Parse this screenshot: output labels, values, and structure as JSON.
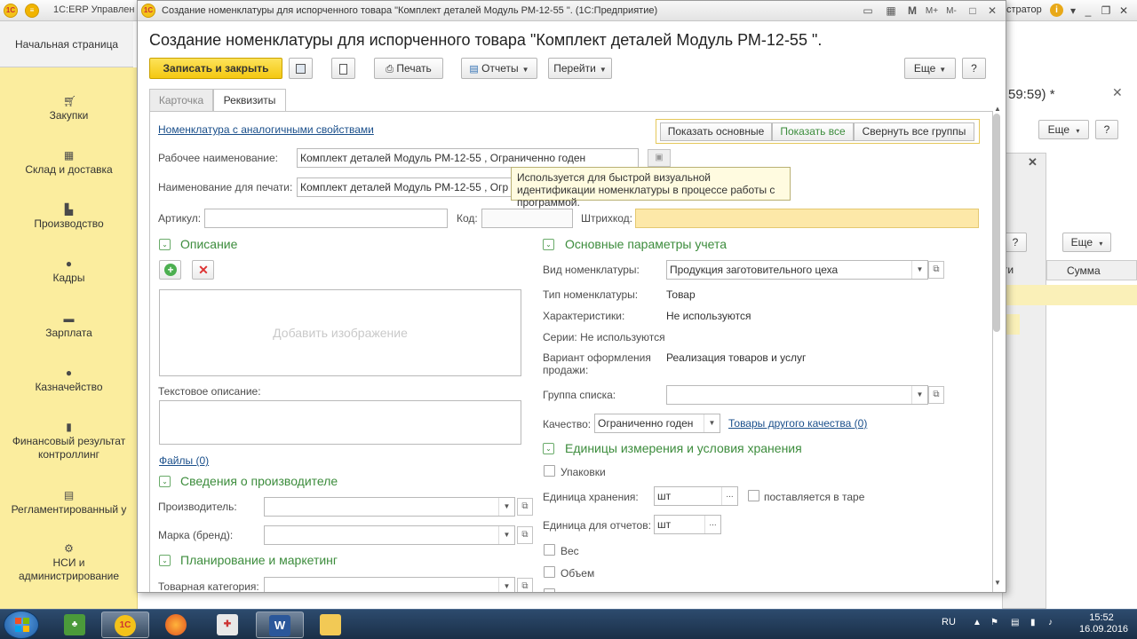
{
  "main_app": {
    "title": "1С:ERP Управлени",
    "user": "стратор",
    "home_tab": "Начальная страница",
    "sidebar": [
      {
        "label": "Закупки",
        "icon": "cart-icon"
      },
      {
        "label": "Склад и доставка",
        "icon": "warehouse-icon"
      },
      {
        "label": "Производство",
        "icon": "factory-icon"
      },
      {
        "label": "Кадры",
        "icon": "person-icon"
      },
      {
        "label": "Зарплата",
        "icon": "wallet-icon"
      },
      {
        "label": "Казначейство",
        "icon": "coin-icon"
      },
      {
        "label": "Финансовый результат",
        "label2": "контроллинг",
        "icon": "bar-chart-icon"
      },
      {
        "label": "Регламентированный у",
        "icon": "calculator-icon"
      },
      {
        "label": "НСИ и",
        "label2": "администрирование",
        "icon": "gear-icon"
      }
    ],
    "background": {
      "time_text": "59:59) *",
      "more_label": "Еще",
      "help_label": "?",
      "col_ti": "ги",
      "col_sum": "Сумма"
    }
  },
  "window": {
    "titlebar": "Создание номенклатуры для испорченного товара \"Комплект деталей Модуль РМ-12-55 \".  (1С:Предприятие)",
    "form_title": "Создание номенклатуры для испорченного товара \"Комплект деталей Модуль РМ-12-55 \".",
    "toolbar": {
      "save_close": "Записать и закрыть",
      "print": "Печать",
      "reports": "Отчеты",
      "goto": "Перейти",
      "more": "Еще",
      "help": "?"
    },
    "tabs": {
      "card": "Карточка",
      "details": "Реквизиты"
    },
    "similar_link": "Номенклатура с аналогичными свойствами",
    "view_buttons": {
      "show_main": "Показать основные",
      "show_all": "Показать все",
      "collapse": "Свернуть все группы"
    },
    "fields": {
      "work_name_label": "Рабочее наименование:",
      "work_name_value": "Комплект деталей Модуль РМ-12-55 , Ограниченно годен",
      "print_name_label": "Наименование для печати:",
      "print_name_value": "Комплект деталей Модуль РМ-12-55 , Огр",
      "article_label": "Артикул:",
      "code_label": "Код:",
      "barcode_label": "Штрихкод:"
    },
    "tooltip": "Используется для быстрой визуальной идентификации номенклатуры в процессе работы с программой.",
    "description": {
      "header": "Описание",
      "add_image": "Добавить изображение",
      "text_desc_label": "Текстовое описание:",
      "files_link": "Файлы (0)"
    },
    "manufacturer": {
      "header": "Сведения о производителе",
      "maker_label": "Производитель:",
      "brand_label": "Марка (бренд):"
    },
    "planning": {
      "header": "Планирование и маркетинг",
      "category_label": "Товарная категория:"
    },
    "accounting": {
      "header": "Основные параметры учета",
      "kind_label": "Вид номенклатуры:",
      "kind_value": "Продукция заготовительного цеха",
      "type_label": "Тип номенклатуры:",
      "type_value": "Товар",
      "chars_label": "Характеристики:",
      "chars_value": "Не используются",
      "series_text": "Серии: Не используются",
      "sale_variant_label1": "Вариант оформления",
      "sale_variant_label2": "продажи:",
      "sale_variant_value": "Реализация товаров и услуг",
      "list_group_label": "Группа списка:",
      "quality_label": "Качество:",
      "quality_value": "Ограниченно годен",
      "other_quality_link": "Товары другого качества (0)"
    },
    "units": {
      "header": "Единицы измерения и условия хранения",
      "packages": "Упаковки",
      "storage_unit_label": "Единица хранения:",
      "storage_unit_value": "шт",
      "tare_label": "поставляется в таре",
      "report_unit_label": "Единица для отчетов:",
      "report_unit_value": "шт",
      "weight": "Вес",
      "volume": "Объем"
    }
  },
  "taskbar": {
    "lang": "RU",
    "time": "15:52",
    "date": "16.09.2016"
  }
}
